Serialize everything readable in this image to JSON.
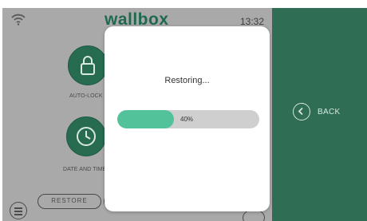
{
  "status_bar": {
    "brand": "wallbox",
    "time": "13:32"
  },
  "settings": {
    "auto_lock_label": "AUTO-LOCK",
    "date_time_label": "DATE AND TIME",
    "restore_label": "RESTORE"
  },
  "modal": {
    "title": "Restoring...",
    "progress_value": 0.4,
    "progress_text": "40%"
  },
  "nav": {
    "back_label": "BACK"
  },
  "colors": {
    "brand_green": "#276b51",
    "progress_fill": "#52c29a",
    "side_panel": "#2f6d55",
    "overlay_gray": "#a9a9a9"
  },
  "icons": [
    "wifi-icon",
    "lock-icon",
    "clock-icon",
    "menu-icon",
    "chat-icon",
    "back-chevron-icon"
  ]
}
